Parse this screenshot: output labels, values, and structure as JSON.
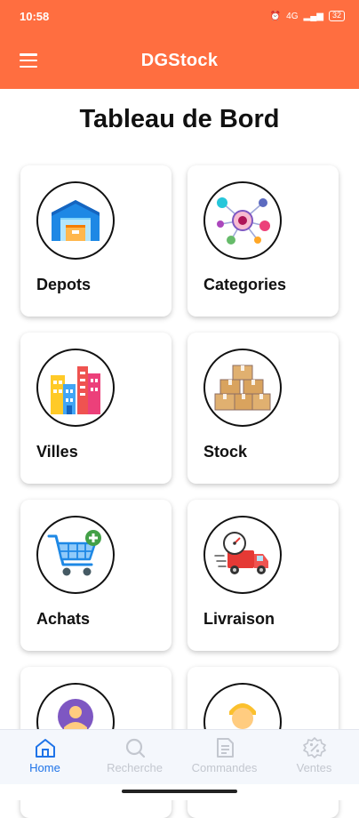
{
  "status": {
    "time": "10:58",
    "battery": "32",
    "signal_text": "4G"
  },
  "app_bar": {
    "title": "DGStock"
  },
  "page_title": "Tableau de Bord",
  "cards": [
    {
      "label": "Depots",
      "icon": "warehouse-icon"
    },
    {
      "label": "Categories",
      "icon": "network-nodes-icon"
    },
    {
      "label": "Villes",
      "icon": "city-buildings-icon"
    },
    {
      "label": "Stock",
      "icon": "boxes-icon"
    },
    {
      "label": "Achats",
      "icon": "shopping-cart-add-icon"
    },
    {
      "label": "Livraison",
      "icon": "delivery-truck-icon"
    },
    {
      "label": "",
      "icon": "team-users-icon"
    },
    {
      "label": "",
      "icon": "person-avatar-icon"
    }
  ],
  "bottom_nav": [
    {
      "label": "Home",
      "icon": "home-icon",
      "active": true
    },
    {
      "label": "Recherche",
      "icon": "search-icon",
      "active": false
    },
    {
      "label": "Commandes",
      "icon": "document-icon",
      "active": false
    },
    {
      "label": "Ventes",
      "icon": "percent-icon",
      "active": false
    }
  ],
  "colors": {
    "primary": "#FF6E40",
    "active_nav": "#1E73E8",
    "inactive_nav": "#C3C7CF"
  }
}
